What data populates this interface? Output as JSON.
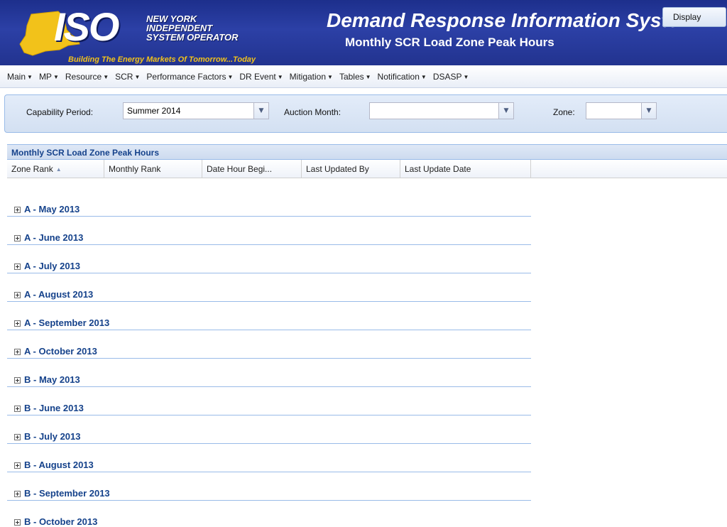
{
  "header": {
    "logo_text": "ISO",
    "logo_org_lines": [
      "NEW YORK",
      "INDEPENDENT",
      "SYSTEM OPERATOR"
    ],
    "logo_tagline": "Building The Energy Markets Of Tomorrow...Today",
    "app_title": "Demand Response Information System",
    "page_title": "Monthly SCR Load Zone Peak Hours",
    "colors": {
      "header_bg": "#2c40a6",
      "tagline": "#f2c21a",
      "state_shape": "#f2c21a"
    }
  },
  "menu": {
    "items": [
      {
        "label": "Main"
      },
      {
        "label": "MP"
      },
      {
        "label": "Resource"
      },
      {
        "label": "SCR"
      },
      {
        "label": "Performance Factors"
      },
      {
        "label": "DR Event"
      },
      {
        "label": "Mitigation"
      },
      {
        "label": "Tables"
      },
      {
        "label": "Notification"
      },
      {
        "label": "DSASP"
      }
    ]
  },
  "filters": {
    "capability_period": {
      "label": "Capability Period:",
      "value": "Summer 2014"
    },
    "auction_month": {
      "label": "Auction Month:",
      "value": ""
    },
    "zone": {
      "label": "Zone:",
      "value": ""
    },
    "display_label": "Display"
  },
  "grid": {
    "title": "Monthly SCR Load Zone Peak Hours",
    "columns": [
      {
        "label": "Zone Rank",
        "sorted": "asc"
      },
      {
        "label": "Monthly Rank"
      },
      {
        "label": "Date Hour Begi..."
      },
      {
        "label": "Last Updated By"
      },
      {
        "label": "Last Update Date"
      }
    ],
    "groups": [
      "A - May 2013",
      "A - June 2013",
      "A - July 2013",
      "A - August 2013",
      "A - September 2013",
      "A - October 2013",
      "B - May 2013",
      "B - June 2013",
      "B - July 2013",
      "B - August 2013",
      "B - September 2013",
      "B - October 2013"
    ],
    "colors": {
      "group_text": "#15428b",
      "border": "#99bbe8"
    }
  }
}
